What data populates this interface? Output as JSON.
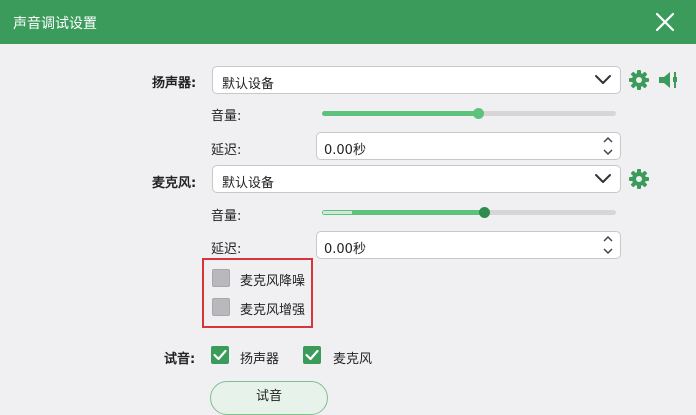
{
  "dialog": {
    "title": "声音调试设置"
  },
  "speaker": {
    "label": "扬声器:",
    "device": "默认设备",
    "volume_label": "音量:",
    "volume_fraction": 0.53,
    "delay_label": "延迟:",
    "delay_value": "0.00秒"
  },
  "microphone": {
    "label": "麦克风:",
    "device": "默认设备",
    "volume_label": "音量:",
    "volume_fraction": 0.55,
    "input_level_fraction": 0.1,
    "delay_label": "延迟:",
    "delay_value": "0.00秒",
    "noise_reduction_label": "麦克风降噪",
    "noise_reduction_checked": false,
    "enhance_label": "麦克风增强",
    "enhance_checked": false
  },
  "test": {
    "label": "试音:",
    "speaker_label": "扬声器",
    "speaker_checked": true,
    "mic_label": "麦克风",
    "mic_checked": true,
    "button_label": "试音"
  },
  "icons": {
    "close": "close-icon",
    "settings": "gear-icon",
    "volume": "volume-icon",
    "dropdown": "chevron-down-icon",
    "check": "check-icon"
  },
  "colors": {
    "title_bar": "#3a9b5b",
    "accent": "#5cc27c",
    "highlight_box": "#d9343a"
  }
}
